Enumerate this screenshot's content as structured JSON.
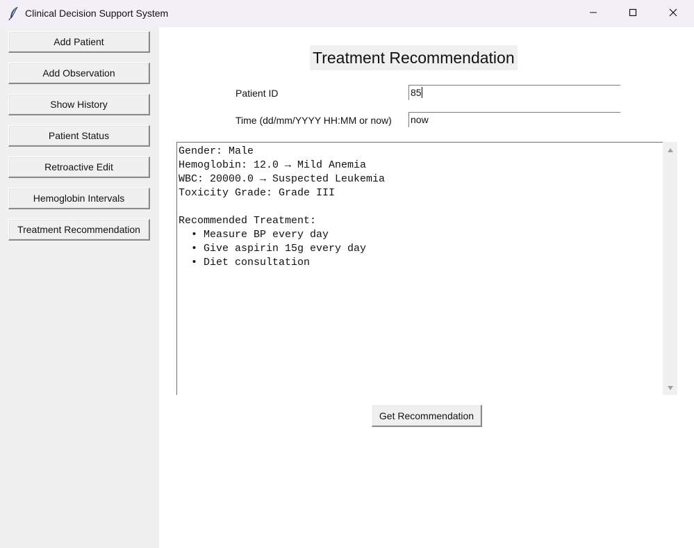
{
  "window": {
    "title": "Clinical Decision Support System",
    "icon": "feather-icon",
    "controls": [
      "minimize-icon",
      "maximize-icon",
      "close-icon"
    ]
  },
  "sidebar": {
    "items": [
      {
        "label": "Add Patient"
      },
      {
        "label": "Add Observation"
      },
      {
        "label": "Show History"
      },
      {
        "label": "Patient Status"
      },
      {
        "label": "Retroactive Edit"
      },
      {
        "label": "Hemoglobin Intervals"
      },
      {
        "label": "Treatment Recommendation"
      }
    ]
  },
  "main": {
    "heading": "Treatment Recommendation",
    "patient_id": {
      "label": "Patient ID",
      "value": "85"
    },
    "time": {
      "label": "Time (dd/mm/YYYY HH:MM or now)",
      "value": "now"
    },
    "output_lines": [
      "Gender: Male",
      "Hemoglobin: 12.0 → Mild Anemia",
      "WBC: 20000.0 → Suspected Leukemia",
      "Toxicity Grade: Grade III",
      "",
      "Recommended Treatment:",
      "  • Measure BP every day",
      "  • Give aspirin 15g every day",
      "  • Diet consultation"
    ],
    "button_label": "Get Recommendation"
  },
  "colors": {
    "titlebar": "#f3eff7",
    "sidebar": "#f0f0f0",
    "main_background": "#ffffff"
  }
}
